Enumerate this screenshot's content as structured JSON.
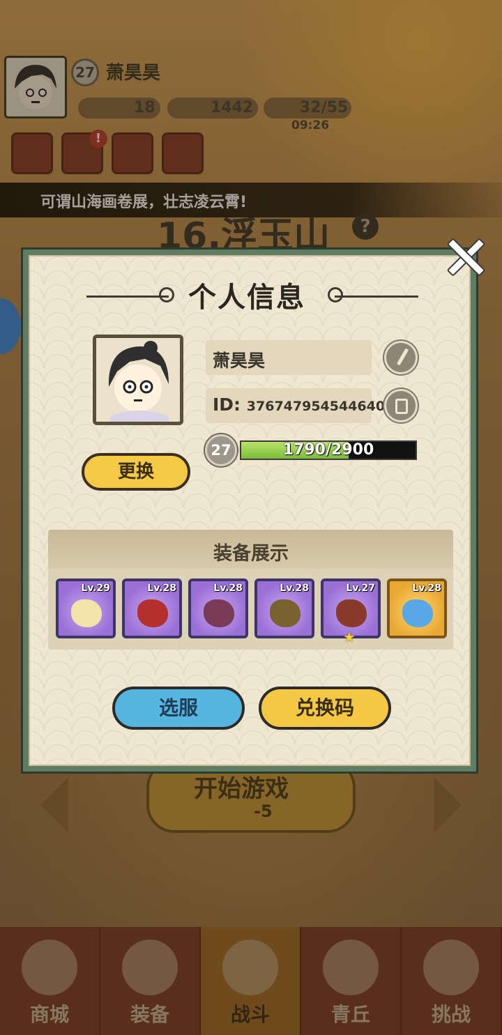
{
  "hud": {
    "level": "27",
    "player_name": "萧昊昊",
    "resources": {
      "currency_a": "18",
      "currency_b": "1442",
      "stamina": "32/55"
    },
    "stamina_timer": "09:26",
    "alert_badge": "!"
  },
  "banner": {
    "text": "可谓山海画卷展，壮志凌云霄!"
  },
  "stage": {
    "title": "16.浮玉山",
    "help": "?"
  },
  "start": {
    "label": "开始游戏",
    "cost": "-5"
  },
  "bottom_nav": [
    {
      "label": "商城"
    },
    {
      "label": "装备"
    },
    {
      "label": "战斗"
    },
    {
      "label": "青丘"
    },
    {
      "label": "挑战"
    }
  ],
  "modal": {
    "title": "个人信息",
    "name": "萧昊昊",
    "id_label": "ID:",
    "id_value": "376747954544640",
    "level": "27",
    "xp_text": "1790/2900",
    "xp_fraction": 0.617,
    "change_button": "更换",
    "equip_title": "装备展示",
    "equipment": [
      {
        "level": "Lv.29",
        "rarity": "purple",
        "item_color": "#f3e3a8"
      },
      {
        "level": "Lv.28",
        "rarity": "purple",
        "item_color": "#b3302c"
      },
      {
        "level": "Lv.28",
        "rarity": "purple",
        "item_color": "#7a3b56"
      },
      {
        "level": "Lv.28",
        "rarity": "purple",
        "item_color": "#7a6230"
      },
      {
        "level": "Lv.27",
        "rarity": "purple",
        "item_color": "#8a3a2a"
      },
      {
        "level": "Lv.28",
        "rarity": "gold",
        "item_color": "#5aa7e8"
      }
    ],
    "server_button": "选服",
    "code_button": "兑换码"
  }
}
